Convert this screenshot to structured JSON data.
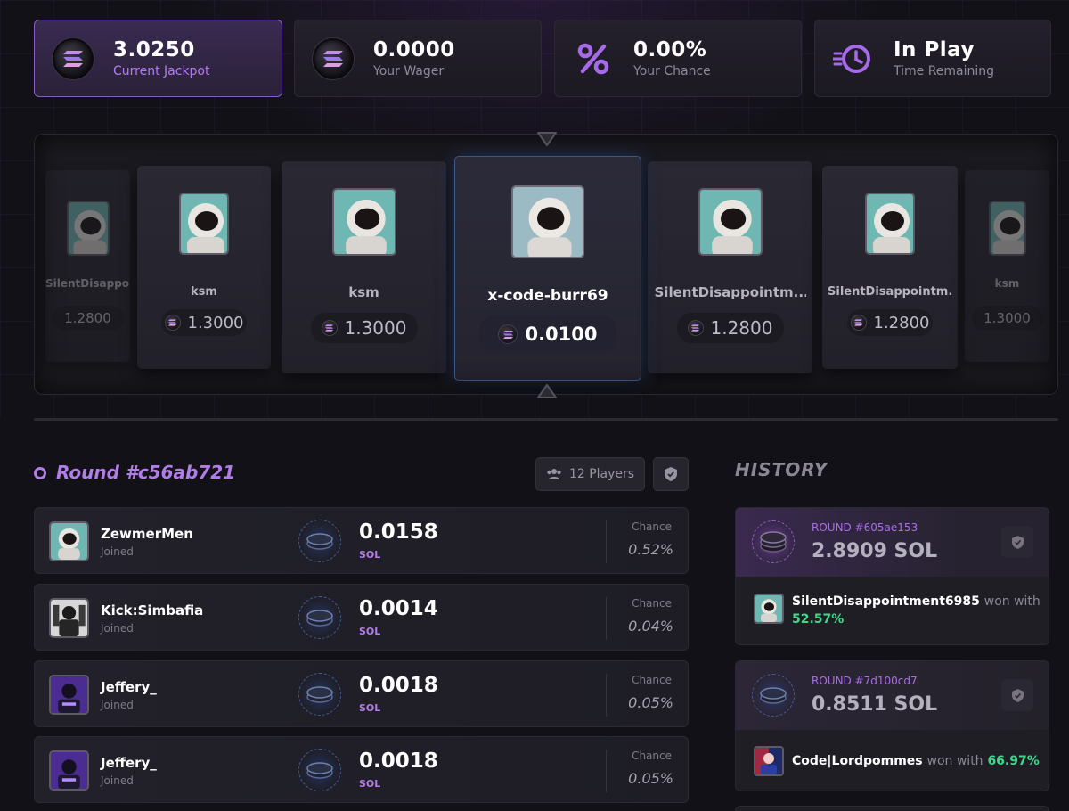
{
  "colors": {
    "accent": "#b17de8",
    "background": "#121117",
    "win_green": "#3ed88a",
    "highlight_blue": "#3e5a8a"
  },
  "stats": [
    {
      "icon": "solana-coin-icon",
      "value": "3.0250",
      "label": "Current Jackpot",
      "active": true
    },
    {
      "icon": "solana-coin-icon",
      "value": "0.0000",
      "label": "Your Wager",
      "active": false
    },
    {
      "icon": "percent-icon",
      "value": "0.00%",
      "label": "Your Chance",
      "active": false
    },
    {
      "icon": "stopwatch-icon",
      "value": "In Play",
      "label": "Time Remaining",
      "active": false
    }
  ],
  "carousel": {
    "cards": [
      {
        "name": "SilentDisappointm...",
        "amount": "1.2800"
      },
      {
        "name": "ksm",
        "amount": "1.3000"
      },
      {
        "name": "ksm",
        "amount": "1.3000"
      },
      {
        "name": "x-code-burr69",
        "amount": "0.0100"
      },
      {
        "name": "SilentDisappointm...",
        "amount": "1.2800"
      },
      {
        "name": "SilentDisappointm...",
        "amount": "1.2800"
      },
      {
        "name": "ksm",
        "amount": "1.3000"
      }
    ]
  },
  "round": {
    "title": "Round #c56ab721",
    "players_label": "12 Players"
  },
  "players": [
    {
      "name": "ZewmerMen",
      "status": "Joined",
      "amount": "0.0158",
      "unit": "SOL",
      "chance_label": "Chance",
      "chance": "0.52%",
      "avatar": "astronaut"
    },
    {
      "name": "Kick:Simbafia",
      "status": "Joined",
      "amount": "0.0014",
      "unit": "SOL",
      "chance_label": "Chance",
      "chance": "0.04%",
      "avatar": "mono"
    },
    {
      "name": "Jeffery_",
      "status": "Joined",
      "amount": "0.0018",
      "unit": "SOL",
      "chance_label": "Chance",
      "chance": "0.05%",
      "avatar": "purple"
    },
    {
      "name": "Jeffery_",
      "status": "Joined",
      "amount": "0.0018",
      "unit": "SOL",
      "chance_label": "Chance",
      "chance": "0.05%",
      "avatar": "purple"
    }
  ],
  "history": {
    "title": "HISTORY",
    "rounds": [
      {
        "round": "ROUND #605ae153",
        "value": "2.8909 SOL",
        "winner": "SilentDisappointment6985",
        "won_text": "won with",
        "pct": "52.57%"
      },
      {
        "round": "ROUND #7d100cd7",
        "value": "0.8511 SOL",
        "winner": "Code|Lordpommes",
        "won_text": "won with",
        "pct": "66.97%"
      }
    ]
  }
}
